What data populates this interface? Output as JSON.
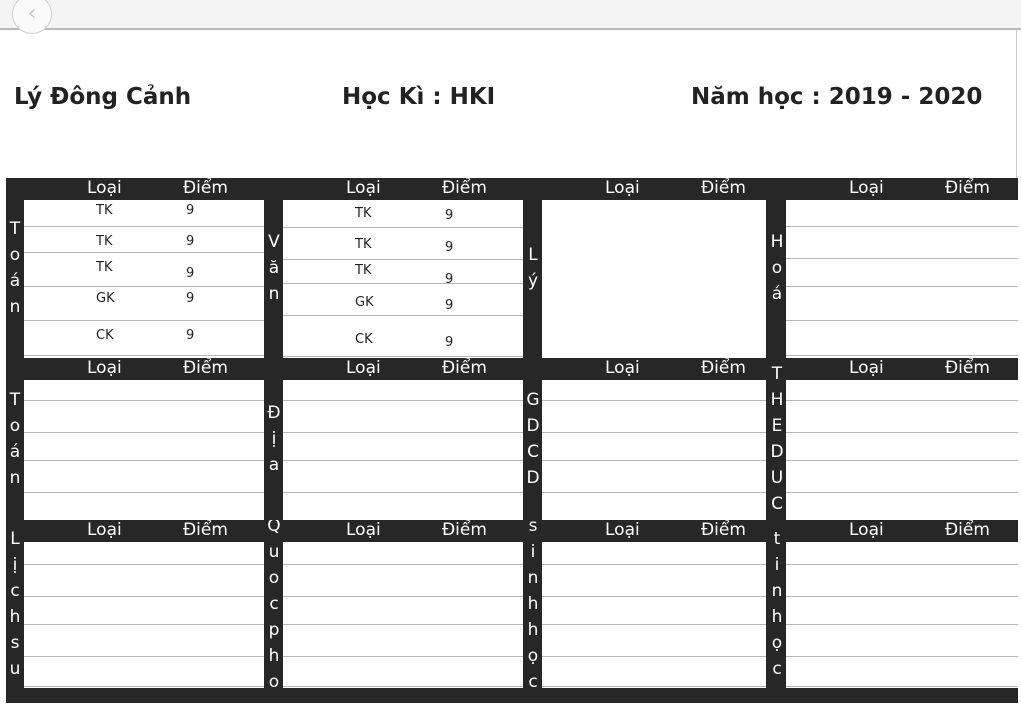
{
  "nav": {
    "back_icon": "chevron-left-icon"
  },
  "header": {
    "student_name": "Lý Đông Cảnh",
    "semester": "Học Kì : HKI",
    "school_year": "Năm học : 2019 - 2020"
  },
  "columns": {
    "type": "Loại",
    "score": "Điểm"
  },
  "subjects": [
    {
      "name": "Toán",
      "letters": [
        "T",
        "o",
        "á",
        "n"
      ],
      "grades": [
        {
          "type": "TK",
          "score": "9"
        },
        {
          "type": "TK",
          "score": "9"
        },
        {
          "type": "TK",
          "score": "9"
        },
        {
          "type": "GK",
          "score": "9"
        },
        {
          "type": "CK",
          "score": "9"
        }
      ]
    },
    {
      "name": "Văn",
      "letters": [
        "V",
        "ă",
        "n"
      ],
      "grades": [
        {
          "type": "TK",
          "score": "9"
        },
        {
          "type": "TK",
          "score": "9"
        },
        {
          "type": "TK",
          "score": "9"
        },
        {
          "type": "GK",
          "score": "9"
        },
        {
          "type": "CK",
          "score": "9"
        }
      ]
    },
    {
      "name": "Lý",
      "letters": [
        "L",
        "ý"
      ],
      "grades": []
    },
    {
      "name": "Hoá",
      "letters": [
        "H",
        "o",
        "á"
      ],
      "grades": []
    },
    {
      "name": "Toán",
      "letters": [
        "T",
        "o",
        "á",
        "n"
      ],
      "grades": []
    },
    {
      "name": "Địa",
      "letters": [
        "Đ",
        "ị",
        "a"
      ],
      "grades": []
    },
    {
      "name": "GDCD",
      "letters": [
        "G",
        "D",
        "C",
        "D"
      ],
      "grades": []
    },
    {
      "name": "THEDUC",
      "letters": [
        "T",
        "H",
        "E",
        "D",
        "U",
        "C"
      ],
      "grades": []
    },
    {
      "name": "Lịchsu",
      "letters": [
        "L",
        "ị",
        "c",
        "h",
        "s",
        "u"
      ],
      "grades": []
    },
    {
      "name": "Quocphong",
      "letters": [
        "Q",
        "u",
        "o",
        "c",
        "p",
        "h",
        "o"
      ],
      "grades": []
    },
    {
      "name": "sinhhọc",
      "letters": [
        "s",
        "i",
        "n",
        "h",
        "h",
        "ọ",
        "c"
      ],
      "grades": []
    },
    {
      "name": "tinhọc",
      "letters": [
        "t",
        "i",
        "n",
        "h",
        "ọ",
        "c"
      ],
      "grades": []
    }
  ]
}
